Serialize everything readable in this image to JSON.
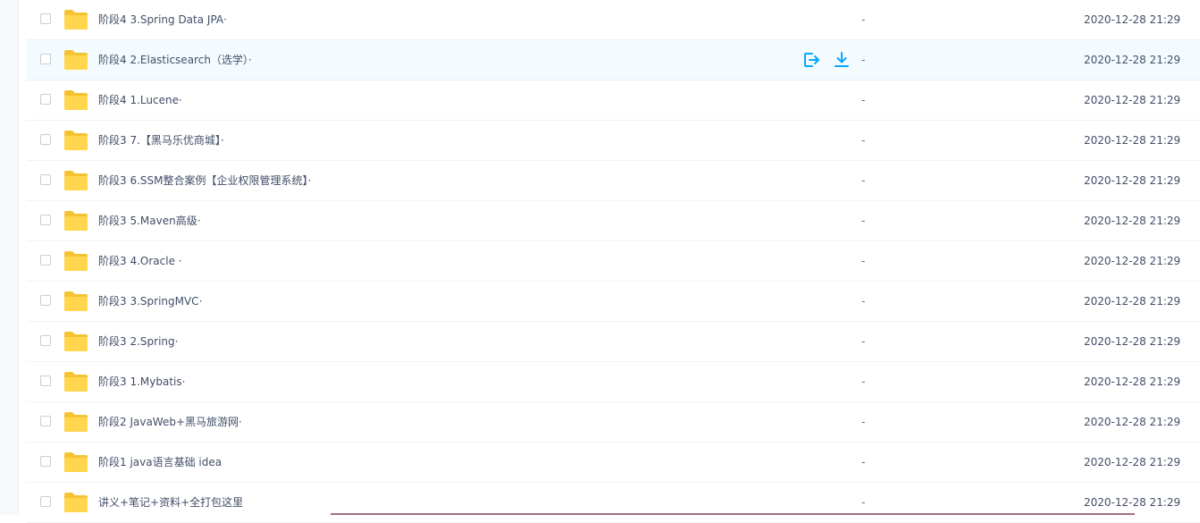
{
  "colors": {
    "folder": "#ffd64e",
    "folder_back": "#f5c332",
    "action_blue": "#06a7ff",
    "text": "#424e67",
    "hover_row": "#f4fbff"
  },
  "file_list": {
    "rows": [
      {
        "name": "阶段4 3.Spring Data JPA·",
        "size": "-",
        "date": "2020-12-28 21:29"
      },
      {
        "name": "阶段4 2.Elasticsearch（选学）·",
        "size": "-",
        "date": "2020-12-28 21:29",
        "hover": true
      },
      {
        "name": "阶段4 1.Lucene·",
        "size": "-",
        "date": "2020-12-28 21:29"
      },
      {
        "name": "阶段3 7.【黑马乐优商城】·",
        "size": "-",
        "date": "2020-12-28 21:29"
      },
      {
        "name": "阶段3 6.SSM整合案例【企业权限管理系统】·",
        "size": "-",
        "date": "2020-12-28 21:29"
      },
      {
        "name": "阶段3 5.Maven高级·",
        "size": "-",
        "date": "2020-12-28 21:29"
      },
      {
        "name": "阶段3 4.Oracle ·",
        "size": "-",
        "date": "2020-12-28 21:29"
      },
      {
        "name": "阶段3 3.SpringMVC·",
        "size": "-",
        "date": "2020-12-28 21:29"
      },
      {
        "name": "阶段3 2.Spring·",
        "size": "-",
        "date": "2020-12-28 21:29"
      },
      {
        "name": "阶段3 1.Mybatis·",
        "size": "-",
        "date": "2020-12-28 21:29"
      },
      {
        "name": "阶段2 JavaWeb+黑马旅游网·",
        "size": "-",
        "date": "2020-12-28 21:29"
      },
      {
        "name": "阶段1 java语言基础 idea",
        "size": "-",
        "date": "2020-12-28 21:29"
      },
      {
        "name": "讲义+笔记+资料+全打包这里",
        "size": "-",
        "date": "2020-12-28 21:29"
      }
    ],
    "hover_actions": [
      {
        "icon": "share-icon"
      },
      {
        "icon": "download-icon"
      }
    ]
  }
}
